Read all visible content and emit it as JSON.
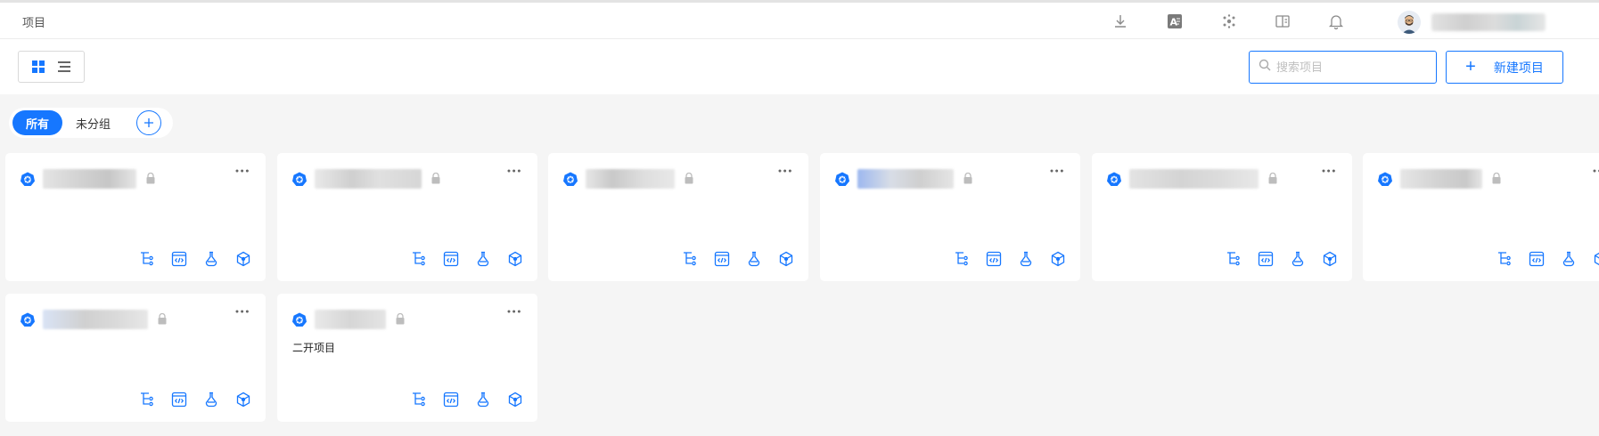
{
  "header": {
    "title": "项目"
  },
  "toolbar": {
    "search_placeholder": "搜索项目",
    "new_project_label": "新建项目",
    "new_project_plus": "+"
  },
  "groups": [
    {
      "label": "所有",
      "active": true
    },
    {
      "label": "未分组",
      "active": false
    }
  ],
  "cards": [
    {
      "description": ""
    },
    {
      "description": ""
    },
    {
      "description": ""
    },
    {
      "description": ""
    },
    {
      "description": ""
    },
    {
      "description": ""
    },
    {
      "description": ""
    },
    {
      "description": "二开项目"
    }
  ],
  "icons": {
    "download": "download-icon",
    "translate": "translate-icon",
    "dots": "cluster-icon",
    "docs": "book-icon",
    "bell": "bell-icon",
    "card_actions": [
      "pipeline-icon",
      "code-icon",
      "test-flask-icon",
      "deploy-cube-icon"
    ]
  },
  "colors": {
    "accent": "#1677ff",
    "background": "#f5f5f5"
  }
}
